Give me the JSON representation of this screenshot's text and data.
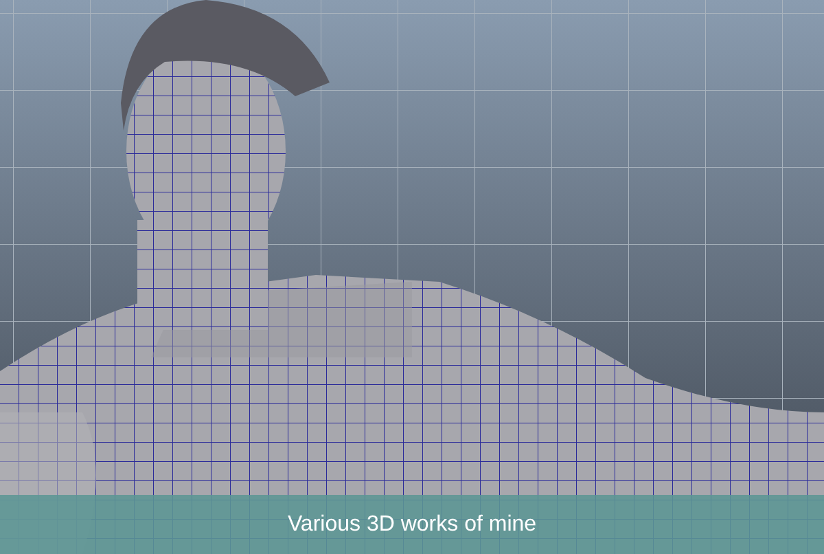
{
  "caption": {
    "text": "Various 3D works of mine"
  }
}
